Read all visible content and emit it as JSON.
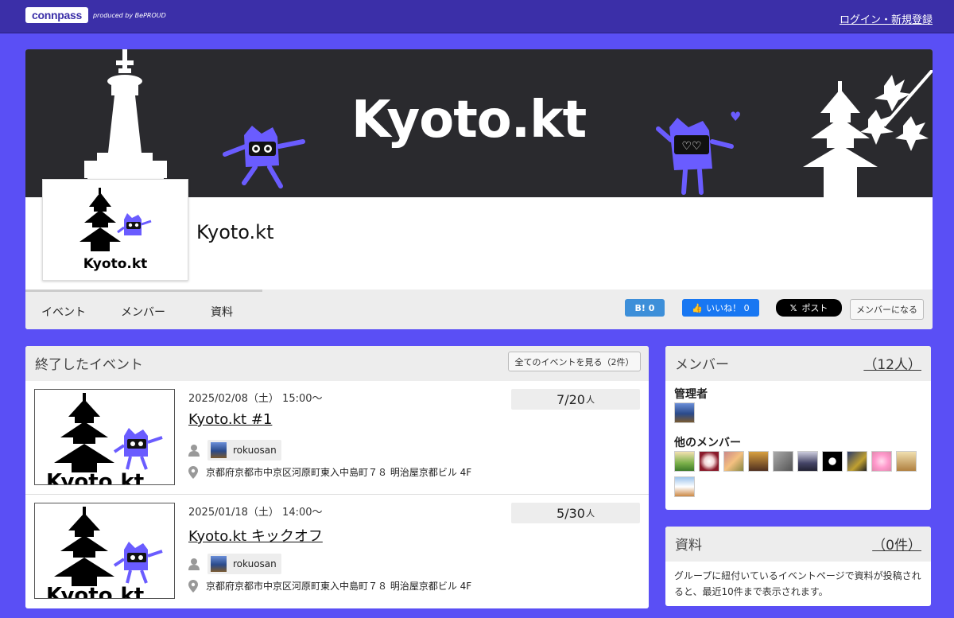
{
  "topbar": {
    "logo": "connpass",
    "produced_by": "produced by BePROUD",
    "login_link": "ログイン・新規登録"
  },
  "group": {
    "banner_title": "Kyoto.kt",
    "logo_text": "Kyoto.kt",
    "name": "Kyoto.kt"
  },
  "tabs": {
    "events": "イベント",
    "members": "メンバー",
    "materials": "資料"
  },
  "share": {
    "hatena": "B! 0",
    "facebook": "いいね！ 0",
    "x_post": "ポスト",
    "join": "メンバーになる"
  },
  "events_panel": {
    "title": "終了したイベント",
    "view_all": "全てのイベントを見る（2件）",
    "items": [
      {
        "thumb_text": "Kyoto.kt",
        "date": "2025/02/08（土） 15:00〜",
        "title": "Kyoto.kt #1",
        "count": "7/20",
        "unit": "人",
        "owner": "rokuosan",
        "address": "京都府京都市中京区河原町東入中島町７８ 明治屋京都ビル 4F"
      },
      {
        "thumb_text": "Kyoto.kt",
        "date": "2025/01/18（土） 14:00〜",
        "title": "Kyoto.kt キックオフ",
        "count": "5/30",
        "unit": "人",
        "owner": "rokuosan",
        "address": "京都府京都市中京区河原町東入中島町７８ 明治屋京都ビル 4F"
      }
    ]
  },
  "members_panel": {
    "title": "メンバー",
    "count": "（12人）",
    "admins_label": "管理者",
    "others_label": "他のメンバー"
  },
  "materials_panel": {
    "title": "資料",
    "count": "（0件）",
    "note": "グループに紐付いているイベントページで資料が投稿されると、最近10件まで表示されます。"
  },
  "colors": {
    "background": "#5a4ff5",
    "topbar": "#3b2fa8",
    "banner": "#2a2a2e",
    "mascot": "#6a5cff"
  }
}
